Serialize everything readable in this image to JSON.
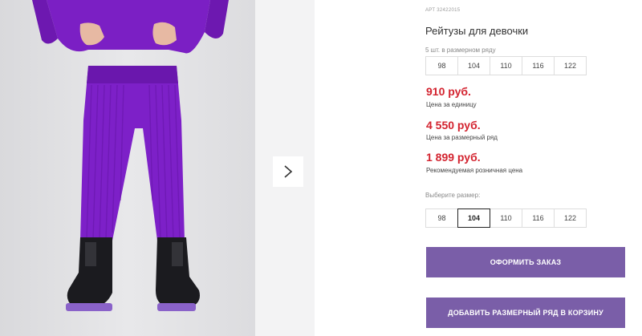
{
  "product": {
    "article": "АРТ 32422015",
    "title": "Рейтузы для девочки"
  },
  "size_series": {
    "caption": "5 шт. в размерном ряду",
    "sizes": [
      "98",
      "104",
      "110",
      "116",
      "122"
    ]
  },
  "prices": [
    {
      "value": "910 руб.",
      "note": "Цена за единицу"
    },
    {
      "value": "4 550 руб.",
      "note": "Цена за размерный ряд"
    },
    {
      "value": "1 899 руб.",
      "note": "Рекомендуемая розничная цена"
    }
  ],
  "size_select": {
    "caption": "Выберите размер:",
    "sizes": [
      "98",
      "104",
      "110",
      "116",
      "122"
    ],
    "selected": "104"
  },
  "actions": {
    "order_label": "ОФОРМИТЬ ЗАКАЗ",
    "add_series_label": "ДОБАВИТЬ РАЗМЕРНЫЙ РЯД В КОРЗИНУ"
  },
  "colors": {
    "price_red": "#d3232f",
    "button_purple": "#7a5ea8",
    "garment_purple": "#7b1fc4"
  },
  "icons": {
    "gallery_next": "chevron-right-icon"
  }
}
